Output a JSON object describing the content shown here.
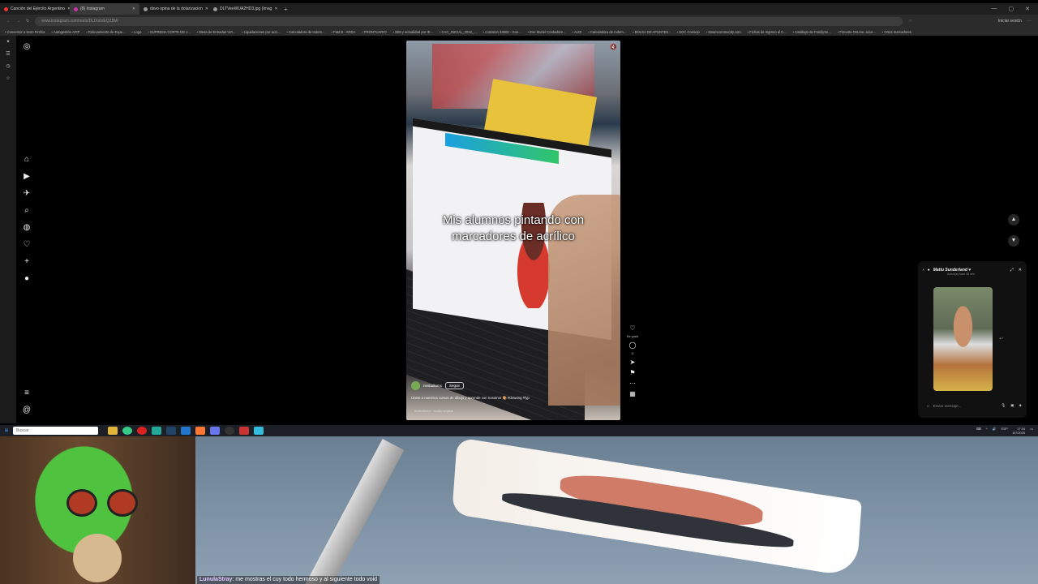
{
  "browser": {
    "tabs": [
      {
        "title": "Canción del Ejército Argentino",
        "color": "#e33"
      },
      {
        "title": "(8) Instagram",
        "color": "#c3a"
      },
      {
        "title": "davo opina de la dolarizacion",
        "color": "#999"
      },
      {
        "title": "DLTVeeWUA2HD3.jpg (Imag",
        "color": "#999"
      }
    ],
    "active_tab": 1,
    "new_tab": "+",
    "url": "www.instagram.com/reels/DLtXsIoEQZ8M/",
    "signin": "Iniciar sesión",
    "bookmarks": [
      "Conversor a texto Firefox",
      "Autogestión AFIP",
      "Relevamiento de Expe...",
      "Logo",
      "SUPREMA CORTE DE J...",
      "Mesa de Entradas Virt...",
      "Liquidaciones por acci...",
      "Calculadora de Indem...",
      "Fast B - ARDA",
      "PRONTUARIO",
      "IBM y actualidad por IE...",
      "CAC_INICIAL_2022_...",
      "comision 23600 - Goo...",
      "Eve Muriel Cordadore...",
      "ALDI",
      "Calculadora de Indem...",
      "BOLSA DE APUNTES -",
      "SOC Consejo",
      "steamcommunity.com",
      "Fichas de Ingreso al C...",
      "Catálogo de FamilySe...",
      "Firevote OnLine, acce...",
      "Otros marcadores"
    ]
  },
  "reel": {
    "caption_line1": "Mis alumnos pintando con",
    "caption_line2": "marcadores de acrílico",
    "username": "riestudiomx",
    "follow": "Seguir",
    "description": "Únete a nuestros cursos de dibujo y aprende con nosotros 🎨 #drawing #fyp",
    "audio": "riestudiomx · Audio original",
    "likes_label": "Me gusta",
    "comments_count": "11"
  },
  "chat": {
    "name": "Mattu Sunderland ♥",
    "activity": "Activo(a) hace 35 min",
    "composer_placeholder": "Enviar mensaje..."
  },
  "taskbar": {
    "search_placeholder": "Buscar",
    "lang": "ESP",
    "time": "17:34",
    "date": "8/7/2025"
  },
  "stream": {
    "chat_user": "LunulaStray",
    "chat_message": ": me mostras el cuy todo hermoso y al siguiente todo void"
  }
}
